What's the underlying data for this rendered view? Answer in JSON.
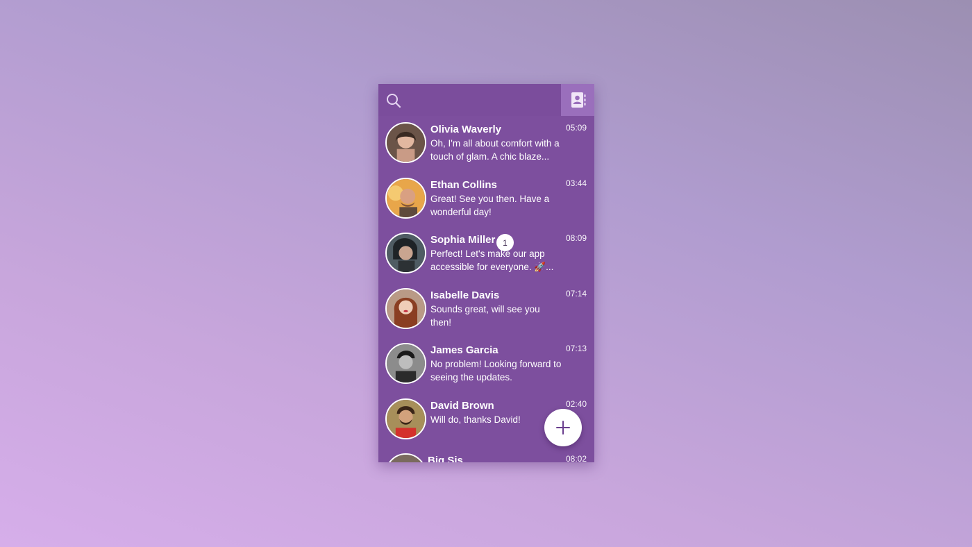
{
  "header": {
    "search_icon": "search-icon",
    "contacts_icon": "contacts-book-icon"
  },
  "conversations": [
    {
      "name": "Olivia Waverly",
      "message": "Oh, I'm all about comfort with a touch of glam. A chic blaze...",
      "time": "05:09",
      "unread": ""
    },
    {
      "name": "Ethan Collins",
      "message": "Great! See you then. Have a wonderful day!",
      "time": "03:44",
      "unread": ""
    },
    {
      "name": "Sophia Miller",
      "message": "Perfect! Let's make our app accessible for everyone. 🚀...",
      "time": "08:09",
      "unread": "1"
    },
    {
      "name": "Isabelle Davis",
      "message": "Sounds great, will see you then!",
      "time": "07:14",
      "unread": ""
    },
    {
      "name": "James Garcia",
      "message": "No problem! Looking forward to seeing the updates.",
      "time": "07:13",
      "unread": ""
    },
    {
      "name": "David Brown",
      "message": "Will do, thanks David!",
      "time": "02:40",
      "unread": ""
    },
    {
      "name": "Big Sis",
      "message": "",
      "time": "08:02",
      "unread": ""
    }
  ],
  "fab": {
    "icon": "plus-icon"
  },
  "colors": {
    "panel": "#7d4f9e",
    "contacts_button": "#9a6fbc",
    "text": "#ffffff"
  }
}
